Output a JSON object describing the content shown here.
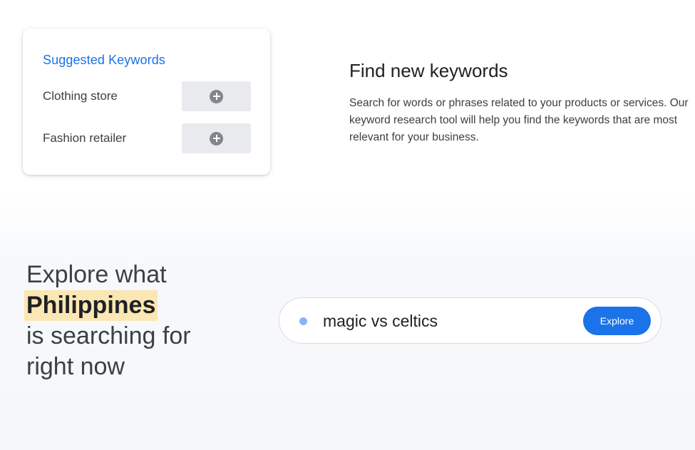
{
  "keywords_card": {
    "title": "Suggested Keywords",
    "items": [
      {
        "label": "Clothing store",
        "action_icon": "add-circle-icon"
      },
      {
        "label": "Fashion retailer",
        "action_icon": "add-circle-icon"
      }
    ]
  },
  "find_section": {
    "title": "Find new keywords",
    "description": "Search for words or phrases related to your products or services. Our keyword research tool will help you find the keywords that are most relevant for your business."
  },
  "explore_section": {
    "line1": "Explore what",
    "country": "Philippines",
    "line3": "is searching for",
    "line4": "right now"
  },
  "search": {
    "value": "magic vs celtics",
    "button_label": "Explore",
    "status_icon": "dot-icon"
  },
  "colors": {
    "accent": "#1a73e8",
    "highlight": "#fbe7b3",
    "dot": "#8ab4f8"
  }
}
